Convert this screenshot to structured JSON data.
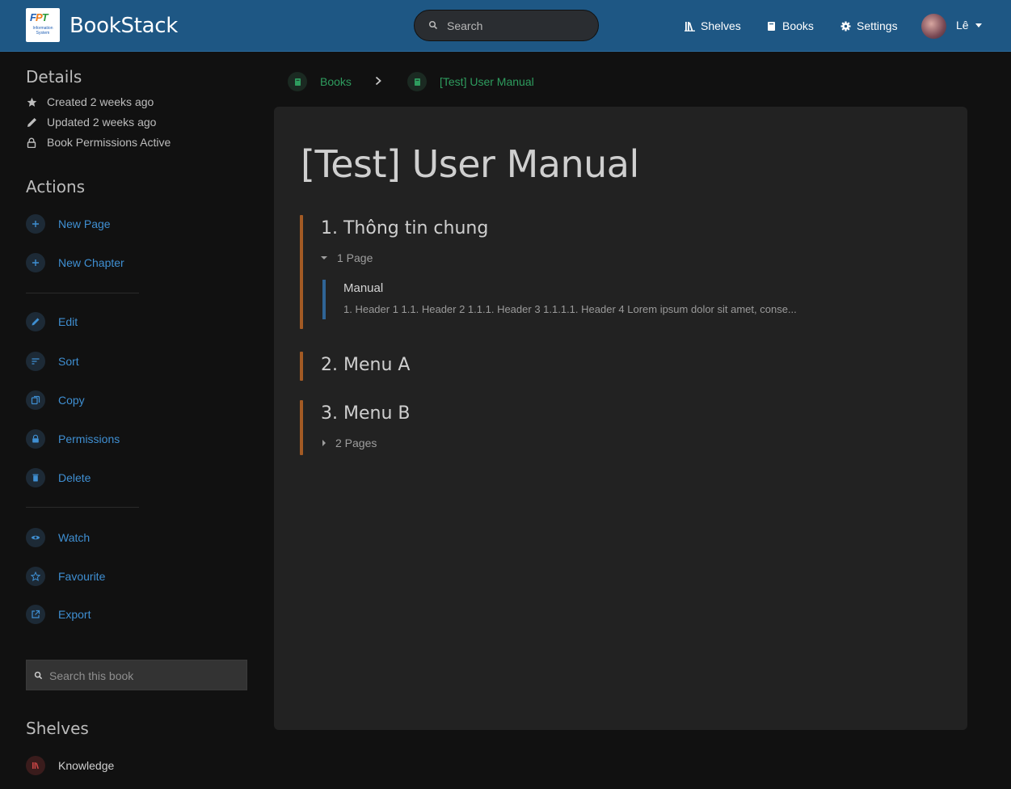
{
  "header": {
    "app_name": "BookStack",
    "logo": {
      "main": [
        "F",
        "P",
        "T"
      ],
      "sub": "Information System"
    },
    "search_placeholder": "Search",
    "nav": {
      "shelves": "Shelves",
      "books": "Books",
      "settings": "Settings"
    },
    "user_name": "Lê"
  },
  "sidebar": {
    "details": {
      "heading": "Details",
      "created": "Created 2 weeks ago",
      "updated": "Updated 2 weeks ago",
      "permissions": "Book Permissions Active"
    },
    "actions": {
      "heading": "Actions",
      "new_page": "New Page",
      "new_chapter": "New Chapter",
      "edit": "Edit",
      "sort": "Sort",
      "copy": "Copy",
      "permissions": "Permissions",
      "delete": "Delete",
      "watch": "Watch",
      "favourite": "Favourite",
      "export": "Export"
    },
    "search_placeholder": "Search this book",
    "shelves": {
      "heading": "Shelves",
      "items": [
        "Knowledge"
      ]
    }
  },
  "breadcrumb": {
    "books": "Books",
    "current": "[Test] User Manual"
  },
  "book": {
    "title": "[Test] User Manual",
    "chapters": [
      {
        "title": "1. Thông tin chung",
        "pages_label": "1 Page"
      },
      {
        "title": "2. Menu A"
      },
      {
        "title": "3. Menu B",
        "pages_label": "2 Pages"
      }
    ],
    "page": {
      "title": "Manual",
      "excerpt": "1. Header 1 1.1. Header 2 1.1.1. Header 3 1.1.1.1. Header 4 Lorem ipsum dolor sit amet, conse..."
    }
  },
  "colors": {
    "header_bg": "#1e5784",
    "page_bg": "#111111",
    "card_bg": "#222222",
    "link": "#3f8fd2",
    "breadcrumb_link": "#2e9c5e",
    "chapter_accent": "#a35a24",
    "page_accent": "#2f6496"
  }
}
